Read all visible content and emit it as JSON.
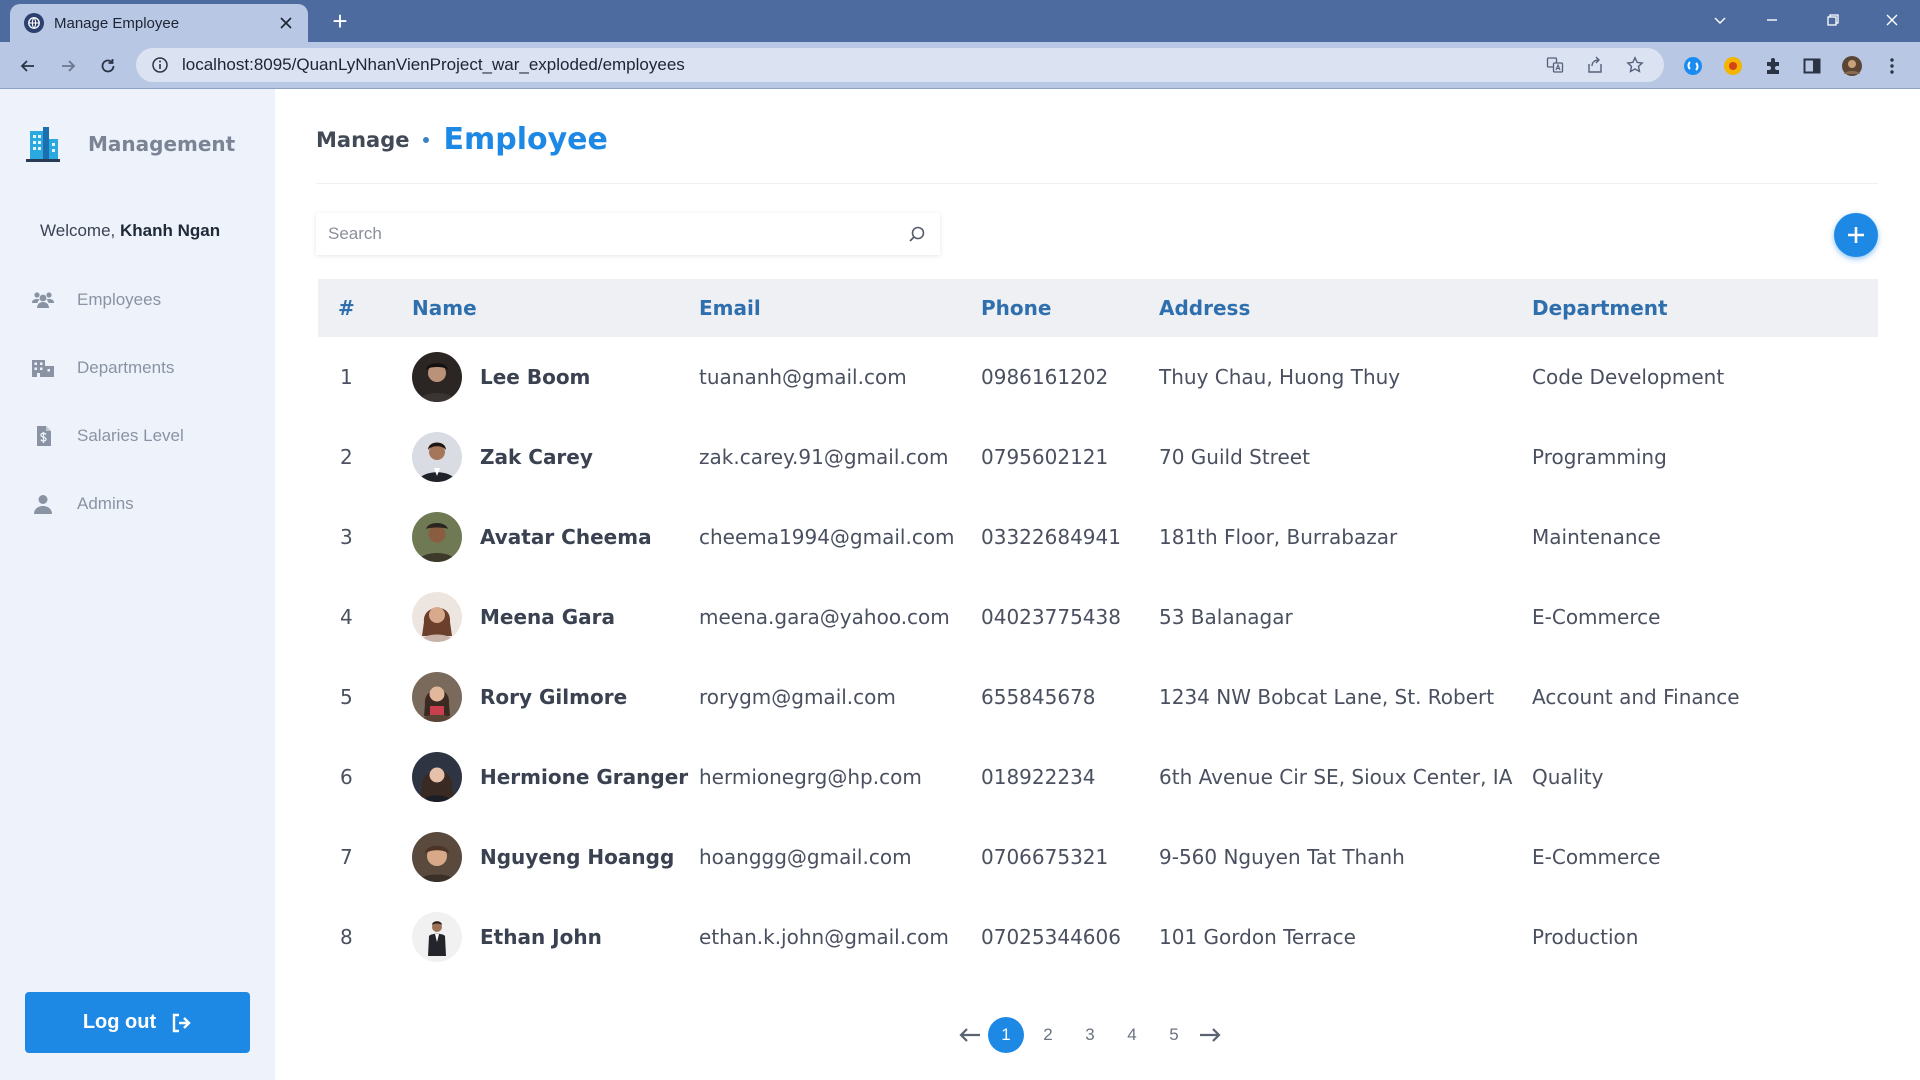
{
  "browser": {
    "tab_title": "Manage Employee",
    "new_tab": "+",
    "url": "localhost:8095/QuanLyNhanVienProject_war_exploded/employees"
  },
  "sidebar": {
    "brand": "Management",
    "welcome_prefix": "Welcome,",
    "user_name": "Khanh Ngan",
    "items": [
      {
        "label": "Employees",
        "icon": "users-icon"
      },
      {
        "label": "Departments",
        "icon": "building-icon"
      },
      {
        "label": "Salaries Level",
        "icon": "salary-file-icon"
      },
      {
        "label": "Admins",
        "icon": "user-icon"
      }
    ],
    "logout_label": "Log out"
  },
  "header": {
    "breadcrumb": "Manage",
    "title": "Employee"
  },
  "search": {
    "placeholder": "Search"
  },
  "table": {
    "columns": [
      "#",
      "Name",
      "Email",
      "Phone",
      "Address",
      "Department"
    ],
    "rows": [
      {
        "id": "1",
        "name": "Lee Boom",
        "email": "tuananh@gmail.com",
        "phone": "0986161202",
        "address": "Thuy Chau, Huong Thuy",
        "department": "Code Development"
      },
      {
        "id": "2",
        "name": "Zak Carey",
        "email": "zak.carey.91@gmail.com",
        "phone": "0795602121",
        "address": "70 Guild Street",
        "department": "Programming"
      },
      {
        "id": "3",
        "name": "Avatar Cheema",
        "email": "cheema1994@gmail.com",
        "phone": "03322684941",
        "address": "181th Floor, Burrabazar",
        "department": "Maintenance"
      },
      {
        "id": "4",
        "name": "Meena Gara",
        "email": "meena.gara@yahoo.com",
        "phone": "04023775438",
        "address": "53 Balanagar",
        "department": "E-Commerce"
      },
      {
        "id": "5",
        "name": "Rory Gilmore",
        "email": "rorygm@gmail.com",
        "phone": "655845678",
        "address": "1234 NW Bobcat Lane, St. Robert",
        "department": "Account and Finance"
      },
      {
        "id": "6",
        "name": "Hermione Granger",
        "email": "hermionegrg@hp.com",
        "phone": "018922234",
        "address": "6th Avenue Cir SE, Sioux Center, IA",
        "department": "Quality"
      },
      {
        "id": "7",
        "name": "Nguyeng Hoangg",
        "email": "hoanggg@gmail.com",
        "phone": "0706675321",
        "address": "9-560 Nguyen Tat Thanh",
        "department": "E-Commerce"
      },
      {
        "id": "8",
        "name": "Ethan John",
        "email": "ethan.k.john@gmail.com",
        "phone": "07025344606",
        "address": "101 Gordon Terrace",
        "department": "Production"
      }
    ]
  },
  "pagination": {
    "pages": [
      "1",
      "2",
      "3",
      "4",
      "5"
    ],
    "current": "1"
  },
  "colors": {
    "accent": "#1e88e5",
    "sidebar_bg": "#eef3fb",
    "header_cell_text": "#2f6fae",
    "browser_frame": "#4e6b9f"
  }
}
